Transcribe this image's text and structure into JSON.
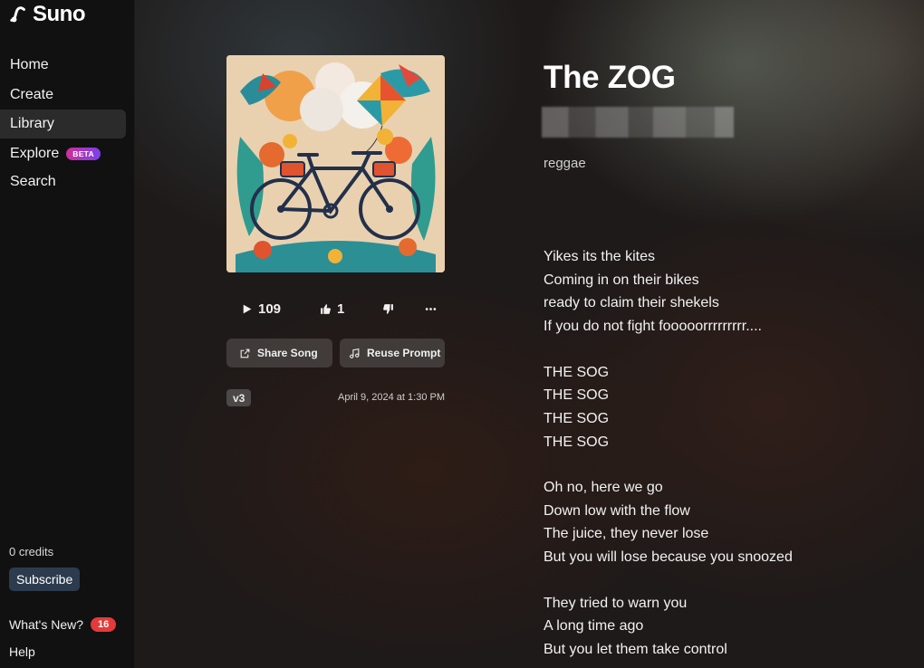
{
  "app": {
    "name": "Suno"
  },
  "sidebar": {
    "items": [
      {
        "label": "Home"
      },
      {
        "label": "Create"
      },
      {
        "label": "Library",
        "active": true
      },
      {
        "label": "Explore",
        "badge": "BETA"
      },
      {
        "label": "Search"
      }
    ],
    "credits": "0 credits",
    "subscribe_label": "Subscribe",
    "whats_new_label": "What's New?",
    "whats_new_count": "16",
    "help_label": "Help"
  },
  "song": {
    "title": "The ZOG",
    "genre": "reggae",
    "plays": "109",
    "likes": "1",
    "share_label": "Share Song",
    "reuse_label": "Reuse Prompt",
    "version": "v3",
    "date": "April 9, 2024 at 1:30 PM",
    "lyrics": [
      [
        "Yikes its the kites",
        "Coming in on their bikes",
        "ready to claim their shekels",
        "If you do not fight fooooorrrrrrrrr...."
      ],
      [
        "THE SOG",
        "THE SOG",
        "THE SOG",
        "THE SOG"
      ],
      [
        "Oh no, here we go",
        "Down low with the flow",
        "The juice, they never lose",
        "But you will lose because you snoozed"
      ],
      [
        "They tried to warn you",
        "A long time ago",
        "But you let them take control"
      ]
    ]
  },
  "colors": {
    "sidebar_bg": "#111111",
    "active_item_bg": "#2b2b2b",
    "subscribe_bg": "#2d3b4e",
    "badge_red": "#e53a3a",
    "beta_gradient_start": "#d0309a",
    "beta_gradient_end": "#7b3ff0"
  },
  "icons": {
    "logo": "suno-wave-icon",
    "play": "play-icon",
    "like": "thumbs-up-icon",
    "dislike": "thumbs-down-icon",
    "more": "more-dots-icon",
    "share": "share-icon",
    "reuse": "music-note-icon"
  }
}
